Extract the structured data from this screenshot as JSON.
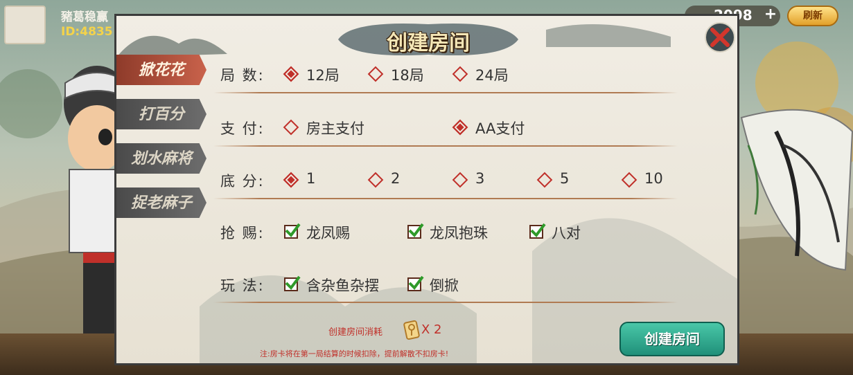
{
  "player": {
    "name": "豬葛稳赢",
    "id": "ID:4835"
  },
  "currency": {
    "value": "2098",
    "refresh_label": "刷新"
  },
  "dialog": {
    "title": "创建房间",
    "tabs": [
      {
        "label": "掀花花",
        "active": true
      },
      {
        "label": "打百分",
        "active": false
      },
      {
        "label": "划水麻将",
        "active": false
      },
      {
        "label": "捉老麻子",
        "active": false
      }
    ],
    "rounds": {
      "label": "局  数:",
      "options": [
        {
          "text": "12局",
          "selected": true
        },
        {
          "text": "18局",
          "selected": false
        },
        {
          "text": "24局",
          "selected": false
        }
      ]
    },
    "payment": {
      "label": "支  付:",
      "options": [
        {
          "text": "房主支付",
          "selected": false
        },
        {
          "text": "AA支付",
          "selected": true
        }
      ]
    },
    "base_score": {
      "label": "底  分:",
      "options": [
        {
          "text": "1",
          "selected": true
        },
        {
          "text": "2",
          "selected": false
        },
        {
          "text": "3",
          "selected": false
        },
        {
          "text": "5",
          "selected": false
        },
        {
          "text": "10",
          "selected": false
        }
      ]
    },
    "grab": {
      "label": "抢  赐:",
      "options": [
        {
          "text": "龙凤赐",
          "checked": true
        },
        {
          "text": "龙凤抱珠",
          "checked": true
        },
        {
          "text": "八对",
          "checked": true
        }
      ]
    },
    "play": {
      "label": "玩  法:",
      "options": [
        {
          "text": "含杂鱼杂摆",
          "checked": true
        },
        {
          "text": "倒掀",
          "checked": true
        }
      ]
    },
    "cost_label": "创建房间消耗",
    "cost_multiplier": "X 2",
    "note": "注:房卡将在第一局结算的时候扣除，提前解散不扣房卡!",
    "create_button": "创建房间"
  },
  "colors": {
    "accent_red": "#c0302a",
    "create_green": "#2aa88c",
    "gold": "#f4d34a"
  }
}
